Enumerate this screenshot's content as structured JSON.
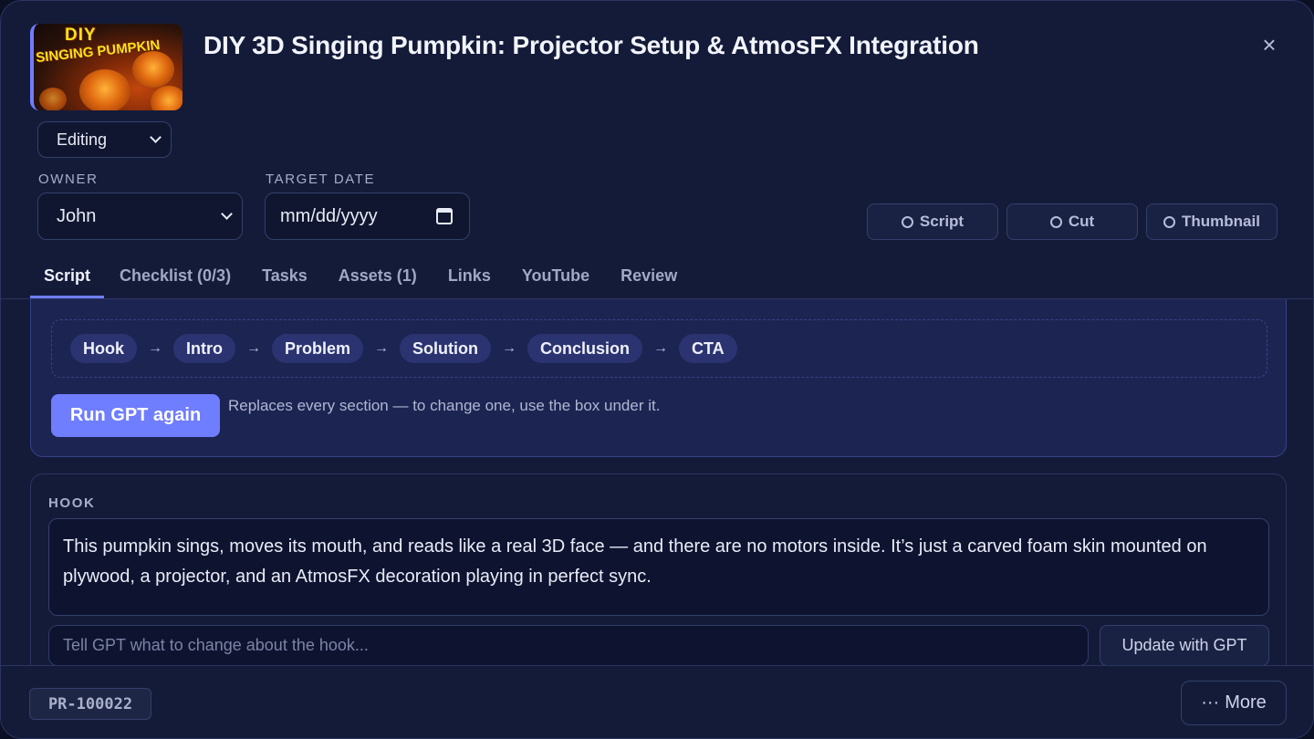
{
  "header": {
    "title": "DIY 3D Singing Pumpkin: Projector Setup & AtmosFX Integration",
    "thumbnail": {
      "line1": "DIY",
      "line2": "SINGING PUMPKIN"
    },
    "close_icon": "×"
  },
  "status": {
    "selected": "Editing"
  },
  "owner": {
    "label": "OWNER",
    "selected": "John"
  },
  "target_date": {
    "label": "TARGET DATE",
    "placeholder": "mm/dd/yyyy"
  },
  "stages": [
    {
      "label": "Script"
    },
    {
      "label": "Cut"
    },
    {
      "label": "Thumbnail"
    }
  ],
  "tabs": [
    {
      "label": "Script",
      "active": true
    },
    {
      "label": "Checklist (0/3)"
    },
    {
      "label": "Tasks"
    },
    {
      "label": "Assets (1)"
    },
    {
      "label": "Links"
    },
    {
      "label": "YouTube"
    },
    {
      "label": "Review"
    }
  ],
  "structure": {
    "sections": [
      "Hook",
      "Intro",
      "Problem",
      "Solution",
      "Conclusion",
      "CTA"
    ],
    "arrow": "→",
    "run_button": "Run GPT again",
    "hint": "Replaces every section — to change one, use the box under it."
  },
  "hook": {
    "label": "HOOK",
    "text": "This pumpkin sings, moves its mouth, and reads like a real 3D face — and there are no motors inside. It’s just a carved foam skin mounted on plywood, a projector, and an AtmosFX decoration playing in perfect sync.",
    "input_placeholder": "Tell GPT what to change about the hook...",
    "update_button": "Update with GPT"
  },
  "footer": {
    "project_id": "PR-100022",
    "more_icon": "···",
    "more_button": "More"
  },
  "colors": {
    "accent": "#6f7dff",
    "background": "#141b39",
    "card": "#1c2452"
  }
}
